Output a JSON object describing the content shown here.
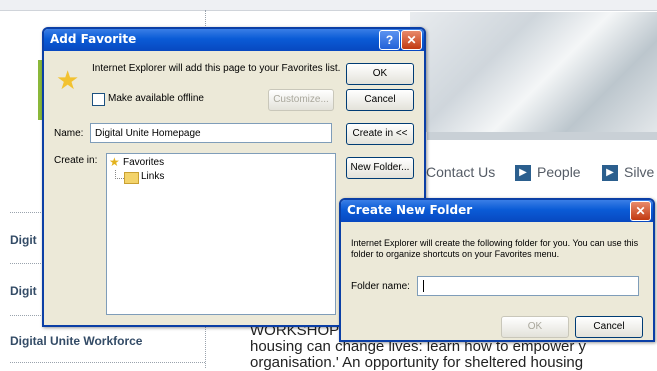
{
  "background_page": {
    "nav": [
      "Contact Us",
      "People",
      "Silve"
    ],
    "sidebar": [
      "Digit",
      "Digit",
      "Digital Unite Workforce"
    ],
    "body_lines": [
      "WORKSHOP",
      "housing can change lives: learn how to empower y",
      "organisation.' An opportunity for sheltered housing"
    ]
  },
  "add_favorite": {
    "title": "Add Favorite",
    "message": "Internet Explorer will add this page to your Favorites list.",
    "offline_label": "Make available offline",
    "customize_label": "Customize...",
    "ok_label": "OK",
    "cancel_label": "Cancel",
    "name_label": "Name:",
    "name_value": "Digital Unite Homepage",
    "create_in_button": "Create in <<",
    "create_in_label": "Create in:",
    "new_folder_button": "New Folder...",
    "tree": [
      "Favorites",
      "Links"
    ]
  },
  "create_folder": {
    "title": "Create New Folder",
    "message": "Internet Explorer will create the following folder for you. You can use this folder to organize shortcuts on your Favorites menu.",
    "folder_label": "Folder name:",
    "folder_value": "",
    "ok_label": "OK",
    "cancel_label": "Cancel"
  },
  "colors": {
    "titlebar": "#0a5bd6",
    "dialog_face": "#ece9d8",
    "accent_green": "#8bb83a"
  }
}
